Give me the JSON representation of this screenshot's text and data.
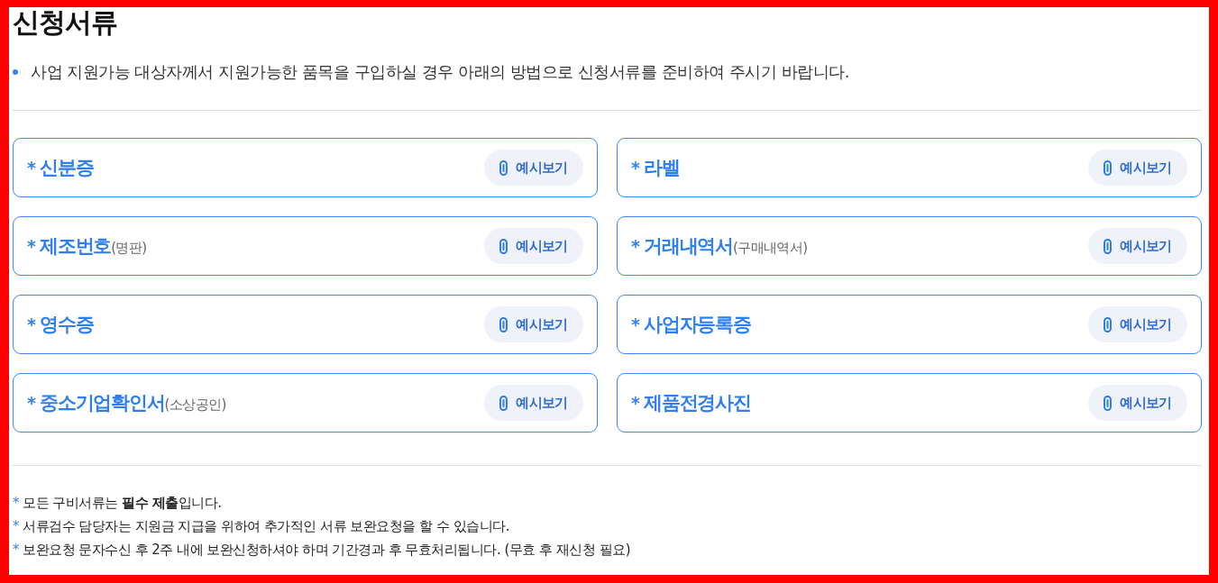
{
  "title": "신청서류",
  "intro": {
    "text": "사업 지원가능 대상자께서 지원가능한 품목을 구입하실 경우 아래의 방법으로 신청서류를 준비하여 주시기 바랍니다."
  },
  "documents": [
    {
      "mark": "*",
      "title": "신분증",
      "button": "예시보기"
    },
    {
      "mark": "*",
      "title": "라벨",
      "button": "예시보기"
    },
    {
      "mark": "*",
      "title": "제조번호",
      "note": "(명판)",
      "button": "예시보기"
    },
    {
      "mark": "*",
      "title": "거래내역서",
      "note": "(구매내역서)",
      "button": "예시보기"
    },
    {
      "mark": "*",
      "title": "영수증",
      "button": "예시보기"
    },
    {
      "mark": "*",
      "title": "사업자등록증",
      "button": "예시보기"
    },
    {
      "mark": "*",
      "title": "중소기업확인서",
      "note": "(소상공인)",
      "button": "예시보기"
    },
    {
      "mark": "*",
      "title": "제품전경사진",
      "button": "예시보기"
    }
  ],
  "notes": [
    {
      "mark": "*",
      "text": "모든 구비서류는 **필수 제출**입니다."
    },
    {
      "mark": "*",
      "text": "서류검수 담당자는 지원금 지급을 위하여 추가적인 서류 보완요청을 할 수 있습니다."
    },
    {
      "mark": "*",
      "text": "보완요청 문자수신 후 2주 내에 보완신청하셔야 하며 기간경과 후 무효처리됩니다. (무효 후 재신청 필요)"
    }
  ]
}
